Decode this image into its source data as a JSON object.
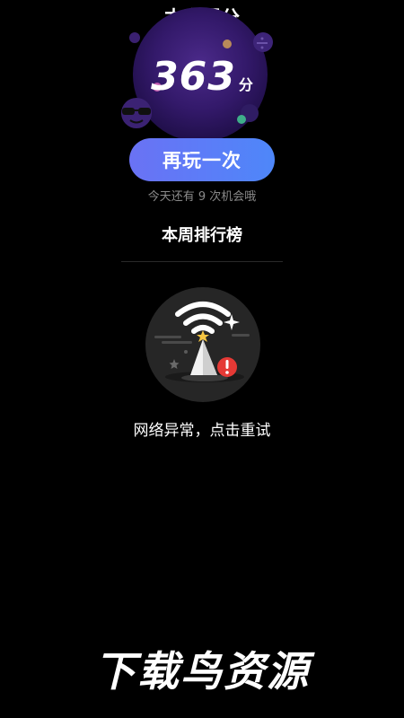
{
  "score": {
    "title": "本次得分",
    "value": "363",
    "unit": "分"
  },
  "replay": {
    "label": "再玩一次",
    "chances_text": "今天还有 9 次机会哦"
  },
  "leaderboard": {
    "title": "本周排行榜",
    "error_text": "网络异常，点击重试"
  },
  "watermark": {
    "text": "下载鸟资源"
  },
  "colors": {
    "background": "#000000",
    "button_gradient_start": "#6a72f4",
    "button_gradient_end": "#4e87f9",
    "orb": "#33196a",
    "error_badge": "#e53935"
  },
  "icons": {
    "wifi": "wifi-icon",
    "sparkle": "sparkle-icon",
    "alert": "alert-icon",
    "sunglasses": "sunglasses-icon"
  }
}
